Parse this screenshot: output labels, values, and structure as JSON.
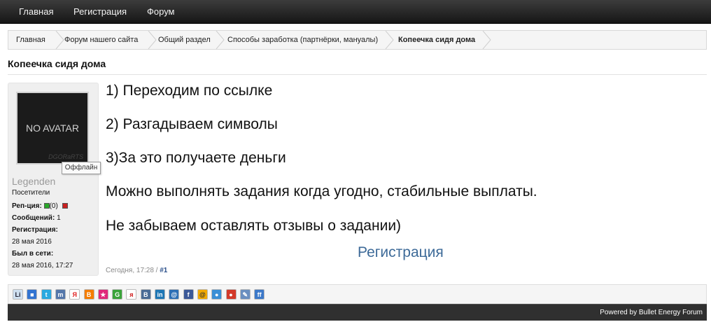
{
  "nav": {
    "items": [
      "Главная",
      "Регистрация",
      "Форум"
    ]
  },
  "breadcrumb": {
    "items": [
      "Главная",
      "Форум нашего сайта",
      "Общий раздел",
      "Способы заработка (партнёрки, мануалы)",
      "Копеечка сидя дома"
    ]
  },
  "thread": {
    "title": "Копеечка сидя дома"
  },
  "user": {
    "avatar_text": "NO AVATAR",
    "avatar_mark": "DGORaRTS",
    "status_tooltip": "Оффлайн",
    "name": "Legenden",
    "group": "Посетители",
    "rep_label": "Реп-ция:",
    "rep_value": "(0)",
    "posts_label": "Сообщений:",
    "posts_value": "1",
    "reg_label": "Регистрация:",
    "reg_value": "28 мая 2016",
    "seen_label": "Был в сети:",
    "seen_value": "28 мая 2016, 17:27"
  },
  "post": {
    "lines": [
      "1) Переходим по ссылке",
      "2) Разгадываем символы",
      "3)За это получаете деньги",
      "Можно выполнять задания когда угодно, стабильные выплаты.",
      "Не забываем оставлять отзывы о задании)"
    ],
    "link": "Регистрация",
    "time": "Сегодня, 17:28 /",
    "permalink": "#1"
  },
  "share": {
    "icons": [
      {
        "name": "liveinternet-icon",
        "glyph": "Li",
        "color": "#cfe0f0",
        "text_color": "#223"
      },
      {
        "name": "delicious-icon",
        "glyph": "■",
        "color": "#3274d1",
        "text_color": "#fff"
      },
      {
        "name": "twitter-icon",
        "glyph": "t",
        "color": "#2aa9e0",
        "text_color": "#fff"
      },
      {
        "name": "myspace-icon",
        "glyph": "m",
        "color": "#5577aa",
        "text_color": "#fff"
      },
      {
        "name": "yandex-icon",
        "glyph": "Я",
        "color": "#ffffff",
        "text_color": "#e02020"
      },
      {
        "name": "blogger-icon",
        "glyph": "B",
        "color": "#f57d00",
        "text_color": "#fff"
      },
      {
        "name": "bookmarks-icon",
        "glyph": "★",
        "color": "#e0287a",
        "text_color": "#fff"
      },
      {
        "name": "google-icon",
        "glyph": "G",
        "color": "#3aa33a",
        "text_color": "#fff"
      },
      {
        "name": "rambler-icon",
        "glyph": "я",
        "color": "#ffffff",
        "text_color": "#d02020"
      },
      {
        "name": "vkontakte-icon",
        "glyph": "В",
        "color": "#4a6b95",
        "text_color": "#fff"
      },
      {
        "name": "linkedin-icon",
        "glyph": "in",
        "color": "#1f77b5",
        "text_color": "#fff"
      },
      {
        "name": "mailru-icon",
        "glyph": "@",
        "color": "#2d6fb5",
        "text_color": "#fff"
      },
      {
        "name": "facebook-icon",
        "glyph": "f",
        "color": "#3b5998",
        "text_color": "#fff"
      },
      {
        "name": "odnoklassniki-icon",
        "glyph": "@",
        "color": "#f2a900",
        "text_color": "#333"
      },
      {
        "name": "moimir-icon",
        "glyph": "●",
        "color": "#3a8fd6",
        "text_color": "#fff"
      },
      {
        "name": "bobrdobr-icon",
        "glyph": "●",
        "color": "#d33a2a",
        "text_color": "#fff"
      },
      {
        "name": "memori-icon",
        "glyph": "✎",
        "color": "#6a8fc0",
        "text_color": "#fff"
      },
      {
        "name": "friendfeed-icon",
        "glyph": "ff",
        "color": "#3c79c9",
        "text_color": "#fff"
      }
    ]
  },
  "footer": {
    "text": "Powered by Bullet Energy Forum"
  },
  "colors": {
    "link": "#3d6a98",
    "nav_bg": "#262626",
    "footer_bg": "#303030"
  }
}
